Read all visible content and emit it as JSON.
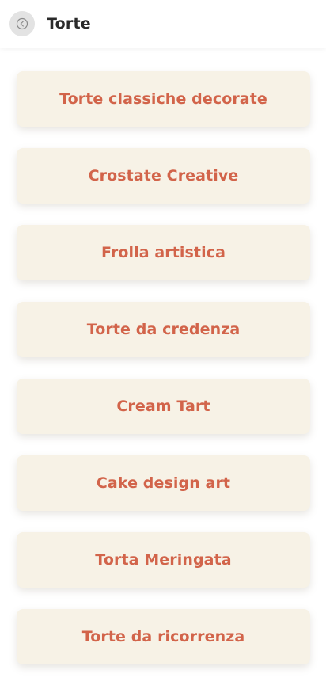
{
  "header": {
    "title": "Torte"
  },
  "colors": {
    "card_background": "#f7f2e6",
    "card_text": "#d2644a",
    "title_text": "#2a2a2a",
    "back_button_bg": "#e3e3e3"
  },
  "icons": {
    "back": "circle-arrow-left-icon"
  },
  "categories": [
    {
      "label": "Torte classiche decorate"
    },
    {
      "label": "Crostate Creative"
    },
    {
      "label": "Frolla artistica"
    },
    {
      "label": "Torte da credenza"
    },
    {
      "label": "Cream Tart"
    },
    {
      "label": "Cake design art"
    },
    {
      "label": "Torta Meringata"
    },
    {
      "label": "Torte da ricorrenza"
    }
  ]
}
